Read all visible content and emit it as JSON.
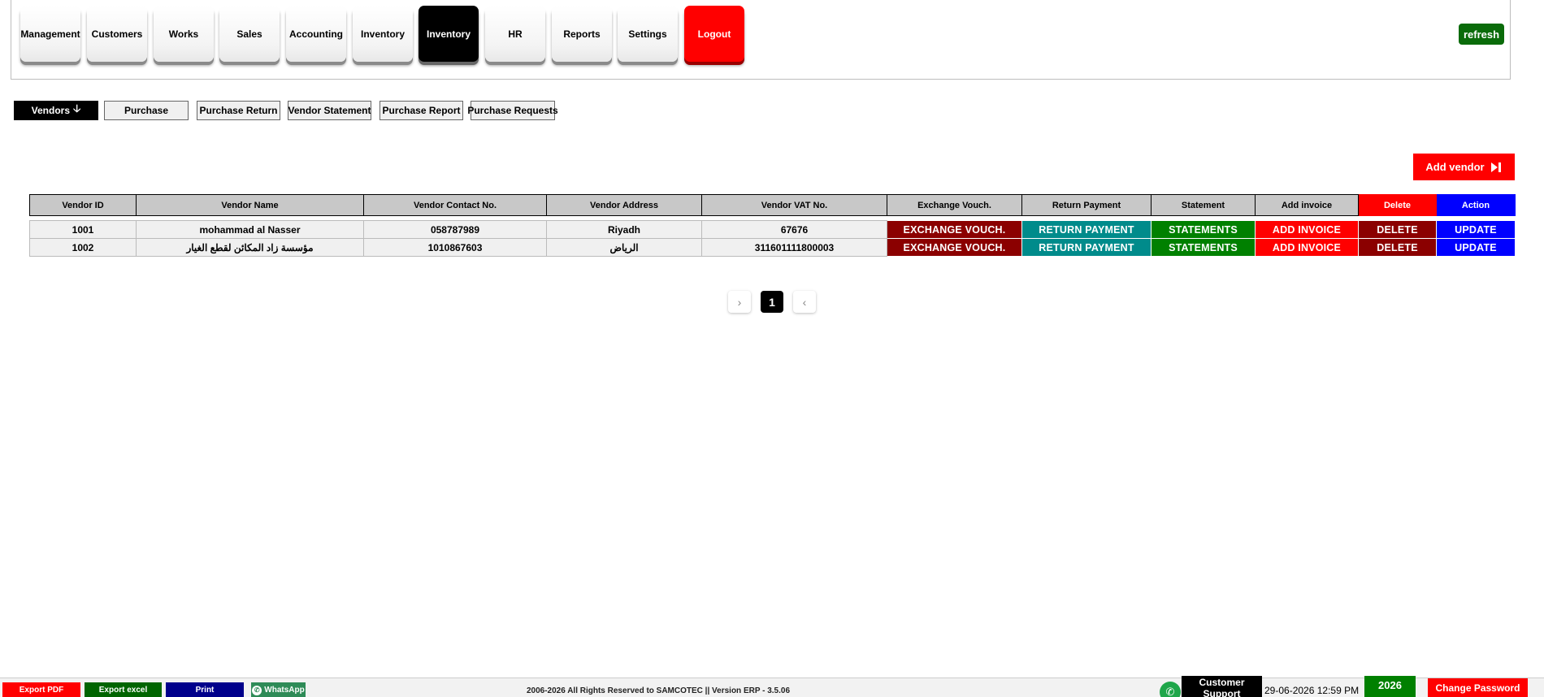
{
  "nav": {
    "management": "Management",
    "customers": "Customers",
    "works": "Works",
    "sales": "Sales",
    "accounting": "Accounting",
    "inventory": "Inventory",
    "inventory_active": "Inventory",
    "hr": "HR",
    "reports": "Reports",
    "settings": "Settings",
    "logout": "Logout"
  },
  "refresh_label": "refresh",
  "subtabs": {
    "vendors": "Vendors",
    "purchase": "Purchase",
    "purchase_return": "Purchase Return",
    "vendor_statement": "Vendor Statement",
    "purchase_report": "Purchase Report",
    "purchase_requests": "Purchase Requests"
  },
  "add_vendor_label": "Add vendor",
  "table": {
    "headers": {
      "id": "Vendor ID",
      "name": "Vendor Name",
      "contact": "Vendor Contact No.",
      "address": "Vendor Address",
      "vat": "Vendor VAT No.",
      "exchange": "Exchange Vouch.",
      "return": "Return Payment",
      "statement": "Statement",
      "add_invoice": "Add invoice",
      "delete": "Delete",
      "action": "Action"
    },
    "rows": [
      {
        "id": "1001",
        "name": "mohammad al Nasser",
        "contact": "058787989",
        "address": "Riyadh",
        "vat": "67676"
      },
      {
        "id": "1002",
        "name": "مؤسسة زاد المكائن لقطع الغيار",
        "contact": "1010867603",
        "address": "الرياض",
        "vat": "311601111800003"
      }
    ],
    "actions": {
      "exchange": "EXCHANGE VOUCH.",
      "return": "RETURN PAYMENT",
      "statement": "STATEMENTS",
      "add_invoice": "ADD INVOICE",
      "delete": "DELETE",
      "update": "UPDATE"
    }
  },
  "pagination": {
    "prev": "›",
    "current": "1",
    "next": "‹"
  },
  "footer": {
    "export_pdf": "Export PDF",
    "export_excel": "Export excel",
    "print": "Print",
    "whatsapp": "WhatsApp",
    "copyright": "2006-2026 All Rights Reserved to SAMCOTEC || Version ERP - 3.5.06",
    "customer_support": "Customer Support",
    "datetime": "29-06-2026 12:59 PM",
    "year": "2026",
    "change_password": "Change Password"
  },
  "colors": {
    "red": "#ff0000",
    "dark_red": "#8b0000",
    "teal": "#008b8b",
    "green": "#008000",
    "blue": "#0000ff"
  }
}
